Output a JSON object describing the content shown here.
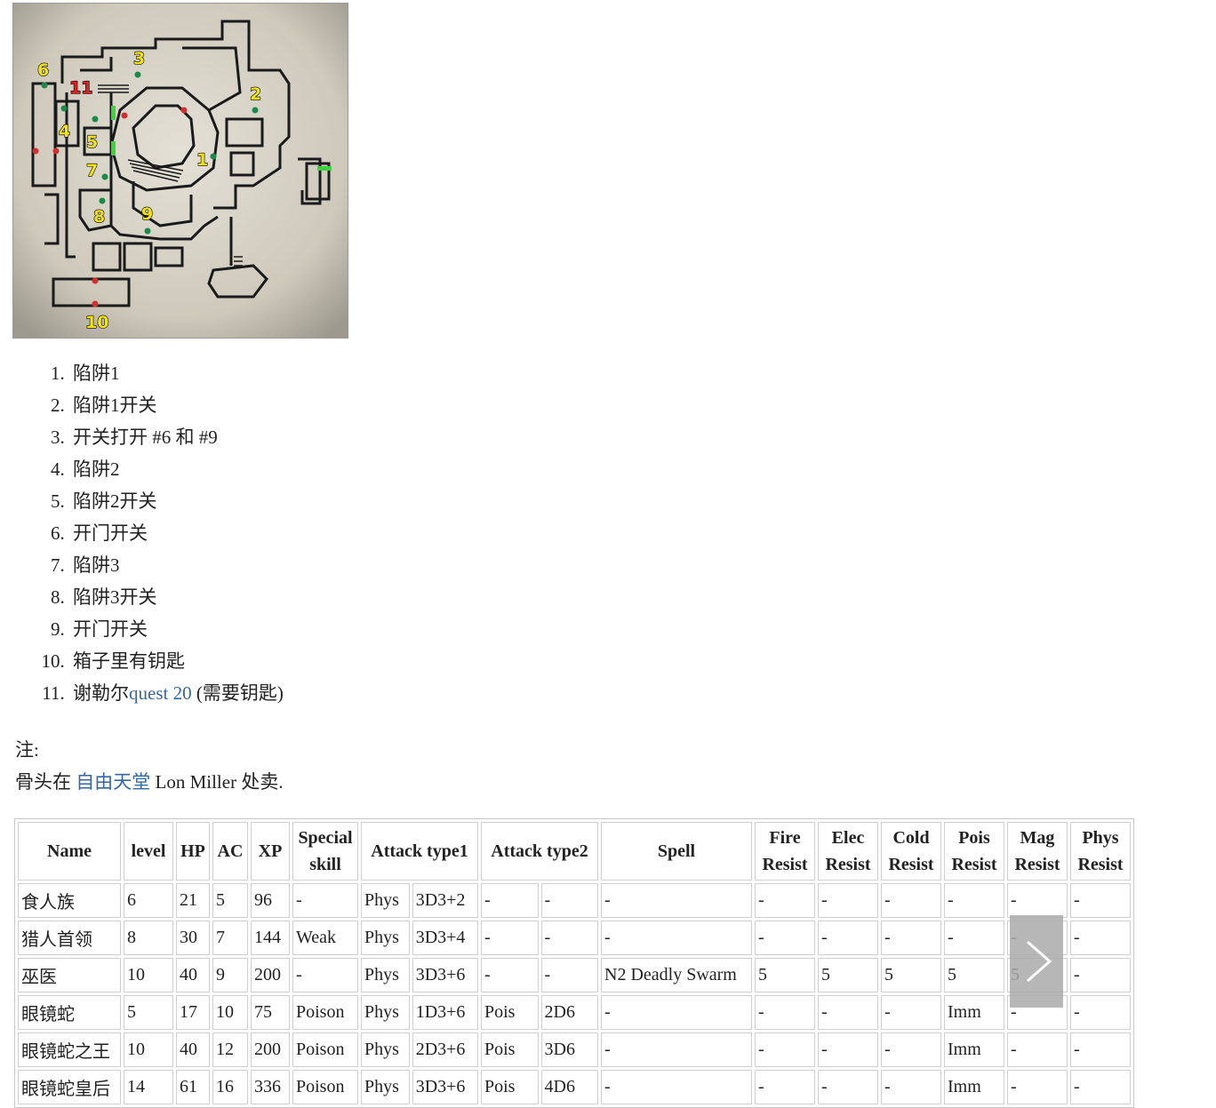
{
  "map": {
    "markers": [
      {
        "n": "1",
        "color": "yellow"
      },
      {
        "n": "2",
        "color": "yellow"
      },
      {
        "n": "3",
        "color": "yellow"
      },
      {
        "n": "4",
        "color": "yellow"
      },
      {
        "n": "5",
        "color": "yellow"
      },
      {
        "n": "6",
        "color": "yellow"
      },
      {
        "n": "7",
        "color": "yellow"
      },
      {
        "n": "8",
        "color": "yellow"
      },
      {
        "n": "9",
        "color": "yellow"
      },
      {
        "n": "10",
        "color": "yellow"
      },
      {
        "n": "11",
        "color": "red"
      }
    ]
  },
  "legend": {
    "items": [
      {
        "text": "陷阱1"
      },
      {
        "text": "陷阱1开关"
      },
      {
        "text": "开关打开 #6 和 #9"
      },
      {
        "text": "陷阱2"
      },
      {
        "text": "陷阱2开关"
      },
      {
        "text": "开门开关"
      },
      {
        "text": "陷阱3"
      },
      {
        "text": "陷阱3开关"
      },
      {
        "text": "开门开关"
      },
      {
        "text": "箱子里有钥匙"
      },
      {
        "pre": "谢勒尔",
        "link": "quest 20",
        "post": " (需要钥匙)"
      }
    ]
  },
  "note": {
    "label": "注:",
    "pre": "骨头在 ",
    "link": "自由天堂",
    "post": " Lon Miller 处卖."
  },
  "table": {
    "headers": [
      {
        "text": "Name",
        "colspan": 1
      },
      {
        "text": "level",
        "colspan": 1
      },
      {
        "text": "HP",
        "colspan": 1
      },
      {
        "text": "AC",
        "colspan": 1
      },
      {
        "text": "XP",
        "colspan": 1
      },
      {
        "text": "Special skill",
        "colspan": 1
      },
      {
        "text": "Attack type1",
        "colspan": 2
      },
      {
        "text": "Attack type2",
        "colspan": 2
      },
      {
        "text": "Spell",
        "colspan": 1
      },
      {
        "text": "Fire Resist",
        "colspan": 1
      },
      {
        "text": "Elec Resist",
        "colspan": 1
      },
      {
        "text": "Cold Resist",
        "colspan": 1
      },
      {
        "text": "Pois Resist",
        "colspan": 1
      },
      {
        "text": "Mag Resist",
        "colspan": 1
      },
      {
        "text": "Phys Resist",
        "colspan": 1
      }
    ],
    "rows": [
      [
        "食人族",
        "6",
        "21",
        "5",
        "96",
        "-",
        "Phys",
        "3D3+2",
        "-",
        "-",
        "-",
        "-",
        "-",
        "-",
        "-",
        "-",
        "-"
      ],
      [
        "猎人首领",
        "8",
        "30",
        "7",
        "144",
        "Weak",
        "Phys",
        "3D3+4",
        "-",
        "-",
        "-",
        "-",
        "-",
        "-",
        "-",
        "-",
        "-"
      ],
      [
        "巫医",
        "10",
        "40",
        "9",
        "200",
        "-",
        "Phys",
        "3D3+6",
        "-",
        "-",
        "N2 Deadly Swarm",
        "5",
        "5",
        "5",
        "5",
        "5",
        "-"
      ],
      [
        "眼镜蛇",
        "5",
        "17",
        "10",
        "75",
        "Poison",
        "Phys",
        "1D3+6",
        "Pois",
        "2D6",
        "-",
        "-",
        "-",
        "-",
        "Imm",
        "-",
        "-"
      ],
      [
        "眼镜蛇之王",
        "10",
        "40",
        "12",
        "200",
        "Poison",
        "Phys",
        "2D3+6",
        "Pois",
        "3D6",
        "-",
        "-",
        "-",
        "-",
        "Imm",
        "-",
        "-"
      ],
      [
        "眼镜蛇皇后",
        "14",
        "61",
        "16",
        "336",
        "Poison",
        "Phys",
        "3D3+6",
        "Pois",
        "4D6",
        "-",
        "-",
        "-",
        "-",
        "Imm",
        "-",
        "-"
      ]
    ]
  }
}
